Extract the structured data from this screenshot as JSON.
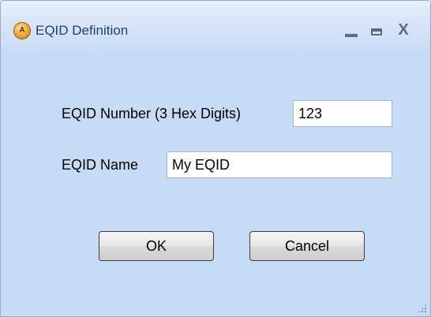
{
  "window": {
    "title": "EQID Definition",
    "icon_text": "A",
    "icon": "app-logo-icon"
  },
  "controls": {
    "minimize": "minimize-icon",
    "maximize": "maximize-icon",
    "close_glyph": "X"
  },
  "form": {
    "number_label": "EQID Number (3 Hex Digits)",
    "number_value": "123",
    "name_label": "EQID Name",
    "name_value": "My EQID"
  },
  "buttons": {
    "ok_label": "OK",
    "cancel_label": "Cancel"
  },
  "colors": {
    "background": "#c6dbf6",
    "title_text": "#1f3f78"
  }
}
